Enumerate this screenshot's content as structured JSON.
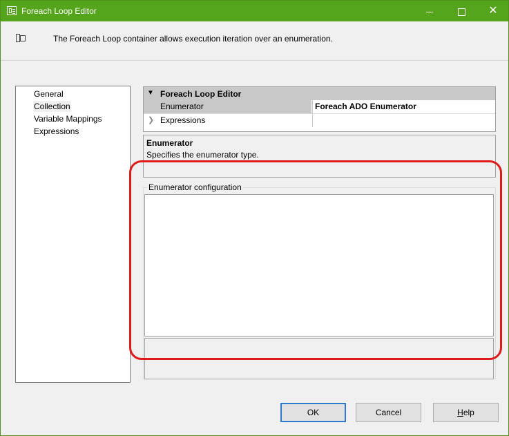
{
  "window": {
    "title": "Foreach Loop Editor"
  },
  "description": "The Foreach Loop container allows execution iteration over an enumeration.",
  "nav": {
    "items": [
      "General",
      "Collection",
      "Variable Mappings",
      "Expressions"
    ],
    "selected": "Collection"
  },
  "property_grid": {
    "category": "Foreach Loop Editor",
    "rows": [
      {
        "name": "Enumerator",
        "value": "Foreach ADO Enumerator"
      },
      {
        "name": "Expressions",
        "value": ""
      }
    ]
  },
  "help_panel": {
    "title": "Enumerator",
    "text": "Specifies the enumerator type."
  },
  "config_group": {
    "label": "Enumerator configuration"
  },
  "buttons": {
    "ok": "OK",
    "cancel": "Cancel",
    "help_prefix": "H",
    "help_rest": "elp"
  },
  "colors": {
    "titlebar": "#55a51c",
    "highlight": "#e01919",
    "default_button_border": "#2f78d2"
  },
  "icons": {
    "window": "foreach-loop-icon",
    "description": "container-icon"
  }
}
